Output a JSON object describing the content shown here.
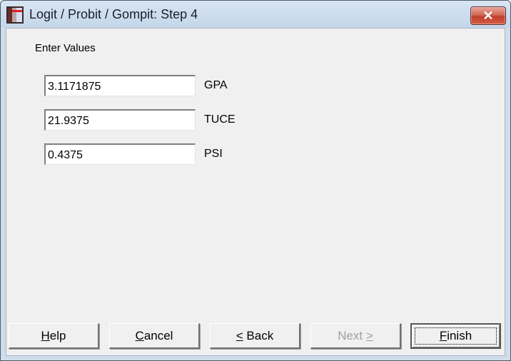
{
  "window": {
    "title": "Logit / Probit / Gompit: Step 4",
    "icon": "app-icon",
    "close_label": "✕"
  },
  "main": {
    "section_label": "Enter Values",
    "fields": [
      {
        "value": "3.1171875",
        "label": "GPA"
      },
      {
        "value": "21.9375",
        "label": "TUCE"
      },
      {
        "value": "0.4375",
        "label": "PSI"
      }
    ]
  },
  "buttons": {
    "help": {
      "mnemonic": "H",
      "rest": "elp",
      "enabled": true
    },
    "cancel": {
      "mnemonic": "C",
      "rest": "ancel",
      "enabled": true
    },
    "back": {
      "mnemonic": "<",
      "rest": " Back",
      "enabled": true
    },
    "next": {
      "prefix": "Next ",
      "mnemonic": ">",
      "enabled": false
    },
    "finish": {
      "mnemonic": "F",
      "rest": "inish",
      "enabled": true,
      "default": true
    }
  }
}
